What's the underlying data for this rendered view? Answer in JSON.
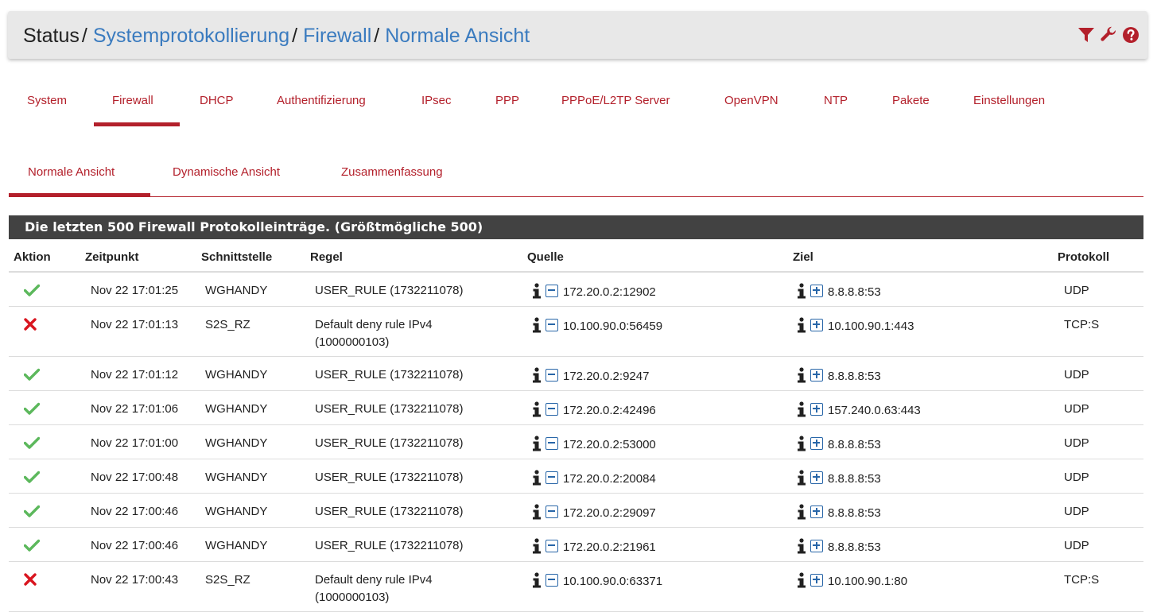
{
  "breadcrumb": {
    "items": [
      "Status",
      "Systemprotokollierung",
      "Firewall",
      "Normale Ansicht"
    ],
    "separator": "/"
  },
  "header_icons": [
    "filter-icon",
    "wrench-icon",
    "help-icon"
  ],
  "main_tabs": [
    "System",
    "Firewall",
    "DHCP",
    "Authentifizierung",
    "IPsec",
    "PPP",
    "PPPoE/L2TP Server",
    "OpenVPN",
    "NTP",
    "Pakete",
    "Einstellungen"
  ],
  "main_tabs_active": "Firewall",
  "sub_tabs": [
    "Normale Ansicht",
    "Dynamische Ansicht",
    "Zusammenfassung"
  ],
  "sub_tabs_active": "Normale Ansicht",
  "panel_title": "Die letzten 500 Firewall Protokolleinträge. (Größtmögliche 500)",
  "table": {
    "headers": [
      "Aktion",
      "Zeitpunkt",
      "Schnittstelle",
      "Regel",
      "Quelle",
      "Ziel",
      "Protokoll"
    ],
    "rows": [
      {
        "action": "pass",
        "time": "Nov 22 17:01:25",
        "iface": "WGHANDY",
        "rule": "USER_RULE (1732211078)",
        "src": "172.20.0.2:12902",
        "dst": "8.8.8.8:53",
        "proto": "UDP"
      },
      {
        "action": "block",
        "time": "Nov 22 17:01:13",
        "iface": "S2S_RZ",
        "rule": "Default deny rule IPv4 (1000000103)",
        "src": "10.100.90.0:56459",
        "dst": "10.100.90.1:443",
        "proto": "TCP:S"
      },
      {
        "action": "pass",
        "time": "Nov 22 17:01:12",
        "iface": "WGHANDY",
        "rule": "USER_RULE (1732211078)",
        "src": "172.20.0.2:9247",
        "dst": "8.8.8.8:53",
        "proto": "UDP"
      },
      {
        "action": "pass",
        "time": "Nov 22 17:01:06",
        "iface": "WGHANDY",
        "rule": "USER_RULE (1732211078)",
        "src": "172.20.0.2:42496",
        "dst": "157.240.0.63:443",
        "proto": "UDP"
      },
      {
        "action": "pass",
        "time": "Nov 22 17:01:00",
        "iface": "WGHANDY",
        "rule": "USER_RULE (1732211078)",
        "src": "172.20.0.2:53000",
        "dst": "8.8.8.8:53",
        "proto": "UDP"
      },
      {
        "action": "pass",
        "time": "Nov 22 17:00:48",
        "iface": "WGHANDY",
        "rule": "USER_RULE (1732211078)",
        "src": "172.20.0.2:20084",
        "dst": "8.8.8.8:53",
        "proto": "UDP"
      },
      {
        "action": "pass",
        "time": "Nov 22 17:00:46",
        "iface": "WGHANDY",
        "rule": "USER_RULE (1732211078)",
        "src": "172.20.0.2:29097",
        "dst": "8.8.8.8:53",
        "proto": "UDP"
      },
      {
        "action": "pass",
        "time": "Nov 22 17:00:46",
        "iface": "WGHANDY",
        "rule": "USER_RULE (1732211078)",
        "src": "172.20.0.2:21961",
        "dst": "8.8.8.8:53",
        "proto": "UDP"
      },
      {
        "action": "block",
        "time": "Nov 22 17:00:43",
        "iface": "S2S_RZ",
        "rule": "Default deny rule IPv4 (1000000103)",
        "src": "10.100.90.0:63371",
        "dst": "10.100.90.1:80",
        "proto": "TCP:S"
      }
    ]
  },
  "colors": {
    "accent": "#b3202b",
    "link": "#3a7bbf",
    "pass": "#5cb85c",
    "block": "#d9151f",
    "panel_header": "#424242"
  }
}
